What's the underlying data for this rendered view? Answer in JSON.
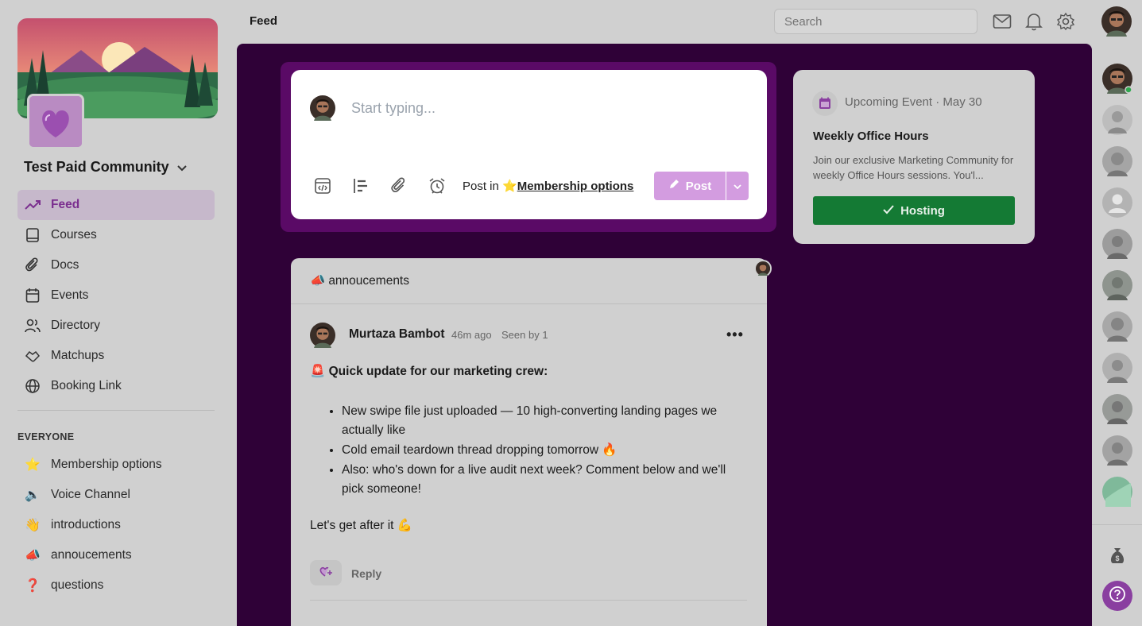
{
  "sidebar": {
    "community_name": "Test Paid Community",
    "nav": [
      {
        "label": "Feed",
        "icon": "trending-up-icon",
        "active": true
      },
      {
        "label": "Courses",
        "icon": "book-icon"
      },
      {
        "label": "Docs",
        "icon": "paperclip-icon"
      },
      {
        "label": "Events",
        "icon": "calendar-icon"
      },
      {
        "label": "Directory",
        "icon": "users-icon"
      },
      {
        "label": "Matchups",
        "icon": "handshake-icon"
      },
      {
        "label": "Booking Link",
        "icon": "globe-icon"
      }
    ],
    "section_title": "EVERYONE",
    "channels": [
      {
        "emoji": "⭐",
        "label": "Membership options"
      },
      {
        "emoji": "🔈",
        "label": "Voice Channel"
      },
      {
        "emoji": "👋",
        "label": "introductions"
      },
      {
        "emoji": "📣",
        "label": "annoucements"
      },
      {
        "emoji": "❓",
        "label": "questions"
      }
    ]
  },
  "topbar": {
    "title": "Feed",
    "search_placeholder": "Search"
  },
  "composer": {
    "placeholder": "Start typing...",
    "post_in_label": "Post in",
    "post_in_emoji": "⭐",
    "post_in_channel": "Membership options",
    "post_button": "Post"
  },
  "event": {
    "label": "Upcoming Event · May 30",
    "title": "Weekly Office Hours",
    "description": "Join our exclusive Marketing Community for weekly Office Hours sessions. You'l...",
    "hosting_button": "Hosting"
  },
  "post": {
    "channel_emoji": "📣",
    "channel": "annoucements",
    "author": "Murtaza Bambot",
    "time": "46m ago",
    "seen": "Seen by 1",
    "headline_emoji": "🚨",
    "headline": "Quick update for our marketing crew:",
    "bullets": [
      "New swipe file just uploaded — 10 high-converting landing pages we actually like",
      "Cold email teardown thread dropping tomorrow 🔥",
      "Also: who's down for a live audit next week? Comment below and we'll pick someone!"
    ],
    "closing": "Let's get after it 💪",
    "reply_label": "Reply"
  },
  "colors": {
    "brand_purple": "#2f0137",
    "accent": "#7b2f8f",
    "post_button": "#d39ce0",
    "hosting_green": "#147a34",
    "help_button": "#8a3fa0"
  }
}
